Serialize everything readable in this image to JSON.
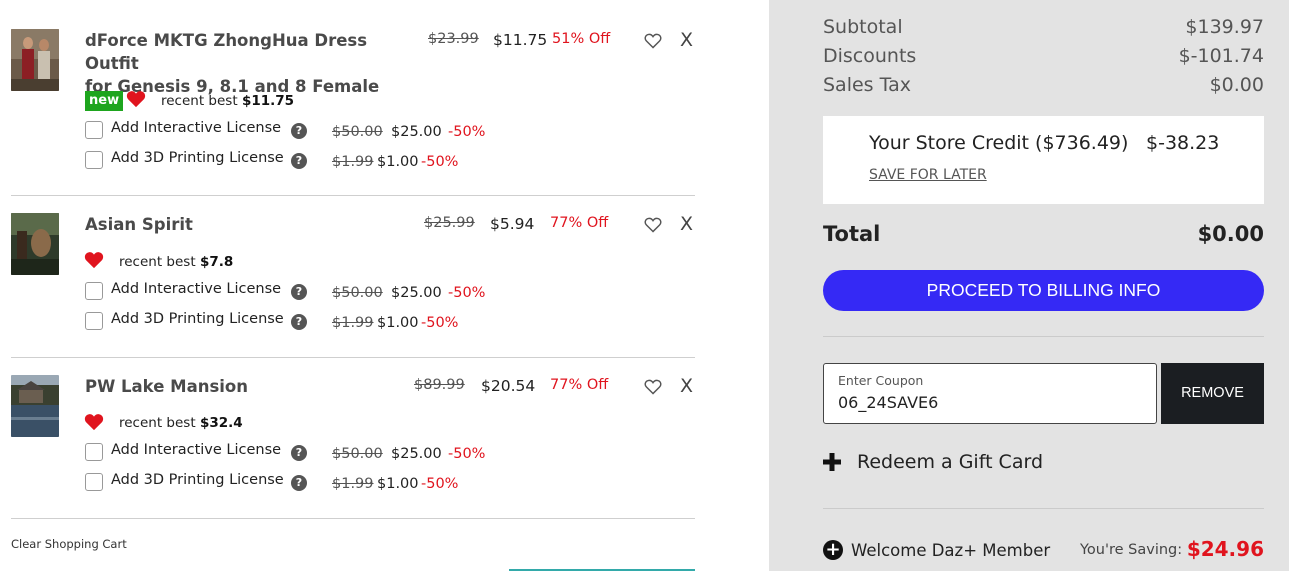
{
  "cart": {
    "items": [
      {
        "title_line1": "dForce MKTG ZhongHua Dress Outfit",
        "title_line2": "for Genesis 9, 8.1 and 8 Female",
        "old_price": "$23.99",
        "price": "$11.75",
        "off": "51% Off",
        "badge": "new",
        "recent_label": "recent best",
        "recent_value": "$11.75",
        "licenses": [
          {
            "label": "Add Interactive License",
            "old": "$50.00",
            "price": "$25.00",
            "off": "-50%"
          },
          {
            "label": "Add 3D Printing License",
            "old": "$1.99",
            "price": "$1.00",
            "off": "-50%"
          }
        ]
      },
      {
        "title_line1": "Asian Spirit",
        "old_price": "$25.99",
        "price": "$5.94",
        "off": "77% Off",
        "recent_label": "recent best",
        "recent_value": "$7.8",
        "licenses": [
          {
            "label": "Add Interactive License",
            "old": "$50.00",
            "price": "$25.00",
            "off": "-50%"
          },
          {
            "label": "Add 3D Printing License",
            "old": "$1.99",
            "price": "$1.00",
            "off": "-50%"
          }
        ]
      },
      {
        "title_line1": "PW Lake Mansion",
        "old_price": "$89.99",
        "price": "$20.54",
        "off": "77% Off",
        "recent_label": "recent best",
        "recent_value": "$32.4",
        "licenses": [
          {
            "label": "Add Interactive License",
            "old": "$50.00",
            "price": "$25.00",
            "off": "-50%"
          },
          {
            "label": "Add 3D Printing License",
            "old": "$1.99",
            "price": "$1.00",
            "off": "-50%"
          }
        ]
      }
    ],
    "remove_glyph": "X",
    "help_glyph": "?",
    "clear_label": "Clear Shopping Cart"
  },
  "summary": {
    "subtotal_label": "Subtotal",
    "subtotal_value": "$139.97",
    "discounts_label": "Discounts",
    "discounts_value": "$-101.74",
    "tax_label": "Sales Tax",
    "tax_value": "$0.00",
    "credit_label": "Your Store Credit ($736.49)",
    "credit_value": "$-38.23",
    "save_later": "SAVE FOR LATER",
    "total_label": "Total",
    "total_value": "$0.00",
    "proceed_label": "PROCEED TO BILLING INFO",
    "coupon_placeholder": "Enter Coupon",
    "coupon_value": "06_24SAVE6",
    "remove_label": "REMOVE",
    "gift_label": "Redeem a Gift Card",
    "member_plus": "+",
    "member_label": "Welcome Daz+ Member",
    "saving_label": "You're Saving:",
    "saving_value": "$24.96"
  },
  "colors": {
    "accent_button": "#3529f5",
    "discount_red": "#e0141e",
    "new_badge": "#1ea51e",
    "panel_bg": "#e3e3e3"
  }
}
